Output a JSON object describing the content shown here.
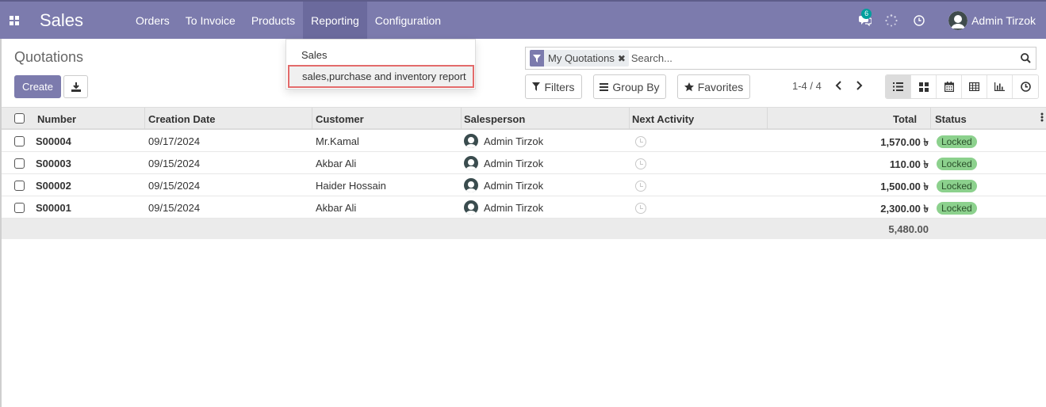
{
  "navbar": {
    "app_title": "Sales",
    "menu": [
      "Orders",
      "To Invoice",
      "Products",
      "Reporting",
      "Configuration"
    ],
    "active_menu": "Reporting",
    "messages_count": "6",
    "user_name": "Admin Tirzok"
  },
  "reporting_dropdown": {
    "items": [
      "Sales",
      "sales,purchase and inventory report"
    ],
    "highlighted": "sales,purchase and inventory report"
  },
  "control_panel": {
    "title": "Quotations",
    "create_label": "Create",
    "facet_label": "My Quotations",
    "search_placeholder": "Search...",
    "filters_label": "Filters",
    "groupby_label": "Group By",
    "favorites_label": "Favorites",
    "pager": "1-4 / 4",
    "views": [
      "list-view-icon",
      "kanban-view-icon",
      "calendar-view-icon",
      "pivot-view-icon",
      "graph-view-icon",
      "activity-view-icon"
    ],
    "active_view": "list-view-icon"
  },
  "table": {
    "columns": [
      "Number",
      "Creation Date",
      "Customer",
      "Salesperson",
      "Next Activity",
      "Total",
      "Status"
    ],
    "rows": [
      {
        "number": "S00004",
        "date": "09/17/2024",
        "customer": "Mr.Kamal",
        "salesperson": "Admin Tirzok",
        "total": "1,570.00 ৳",
        "status": "Locked"
      },
      {
        "number": "S00003",
        "date": "09/15/2024",
        "customer": "Akbar Ali",
        "salesperson": "Admin Tirzok",
        "total": "110.00 ৳",
        "status": "Locked"
      },
      {
        "number": "S00002",
        "date": "09/15/2024",
        "customer": "Haider Hossain",
        "salesperson": "Admin Tirzok",
        "total": "1,500.00 ৳",
        "status": "Locked"
      },
      {
        "number": "S00001",
        "date": "09/15/2024",
        "customer": "Akbar Ali",
        "salesperson": "Admin Tirzok",
        "total": "2,300.00 ৳",
        "status": "Locked"
      }
    ],
    "grand_total": "5,480.00"
  },
  "colors": {
    "brand": "#7c7bad",
    "status_locked": "#8cd18d",
    "highlight_border": "#e36b6b"
  }
}
